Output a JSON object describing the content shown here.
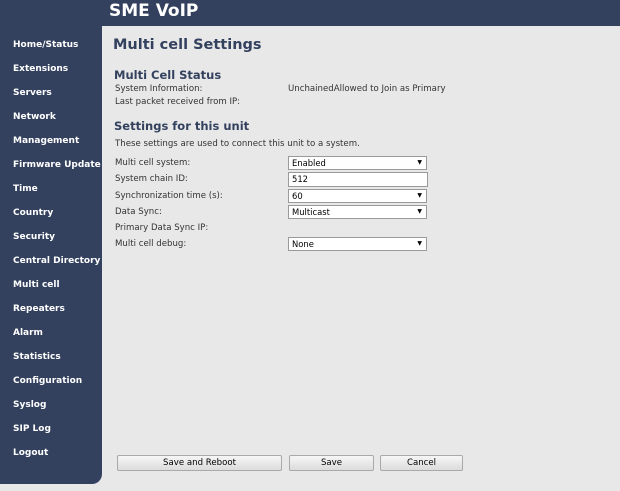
{
  "header": {
    "title": "SME VoIP"
  },
  "sidebar": {
    "items": [
      {
        "label": "Home/Status"
      },
      {
        "label": "Extensions"
      },
      {
        "label": "Servers"
      },
      {
        "label": "Network"
      },
      {
        "label": "Management"
      },
      {
        "label": "Firmware Update"
      },
      {
        "label": "Time"
      },
      {
        "label": "Country"
      },
      {
        "label": "Security"
      },
      {
        "label": "Central Directory"
      },
      {
        "label": "Multi cell"
      },
      {
        "label": "Repeaters"
      },
      {
        "label": "Alarm"
      },
      {
        "label": "Statistics"
      },
      {
        "label": "Configuration"
      },
      {
        "label": "Syslog"
      },
      {
        "label": "SIP Log"
      },
      {
        "label": "Logout"
      }
    ]
  },
  "main": {
    "title": "Multi cell Settings",
    "status": {
      "title": "Multi Cell Status",
      "system_info_label": "System Information:",
      "system_info_value": "UnchainedAllowed to Join as Primary",
      "last_packet_label": "Last packet received from IP:"
    },
    "settings": {
      "title": "Settings for this unit",
      "description": "These settings are used to connect this unit to a system.",
      "multicell_label": "Multi cell system:",
      "multicell_value": "Enabled",
      "chain_id_label": "System chain ID:",
      "chain_id_value": "512",
      "sync_time_label": "Synchronization time (s):",
      "sync_time_value": "60",
      "data_sync_label": "Data Sync:",
      "data_sync_value": "Multicast",
      "primary_ip_label": "Primary Data Sync IP:",
      "debug_label": "Multi cell debug:",
      "debug_value": "None"
    },
    "buttons": {
      "save_reboot": "Save and Reboot",
      "save": "Save",
      "cancel": "Cancel"
    }
  }
}
